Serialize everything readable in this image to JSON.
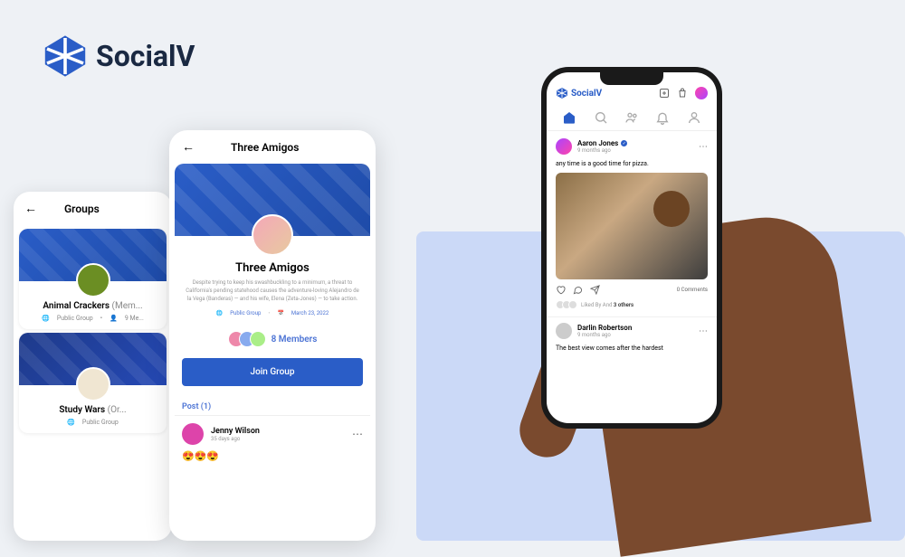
{
  "brand": {
    "name": "SocialV"
  },
  "phone1": {
    "title": "Groups",
    "groups": [
      {
        "name": "Animal Crackers",
        "suffix": "(Mem...",
        "type": "Public Group",
        "members": "9 Me..."
      },
      {
        "name": "Study Wars",
        "suffix": "(Or...",
        "type": "Public Group"
      }
    ]
  },
  "phone2": {
    "title": "Three Amigos",
    "group_name": "Three Amigos",
    "description": "Despite trying to keep his swashbuckling to a minimum, a threat to California's pending statehood causes the adventure-loving Alejandro de la Vega (Banderas) — and his wife, Elena (Zeta-Jones) — to take action.",
    "type": "Public Group",
    "date": "March 23, 2022",
    "members": "8 Members",
    "join": "Join Group",
    "post_label": "Post (1)",
    "post": {
      "author": "Jenny Wilson",
      "time": "35 days ago"
    }
  },
  "phone3": {
    "brand": "SocialV",
    "post1": {
      "author": "Aaron Jones",
      "time": "9 months ago",
      "text": "any time is a good time for pizza.",
      "comments": "0 Comments",
      "liked_prefix": "Liked By  And",
      "liked_suffix": "3 others"
    },
    "post2": {
      "author": "Darlin Robertson",
      "time": "9 months ago",
      "text": "The best view comes after the hardest"
    }
  }
}
